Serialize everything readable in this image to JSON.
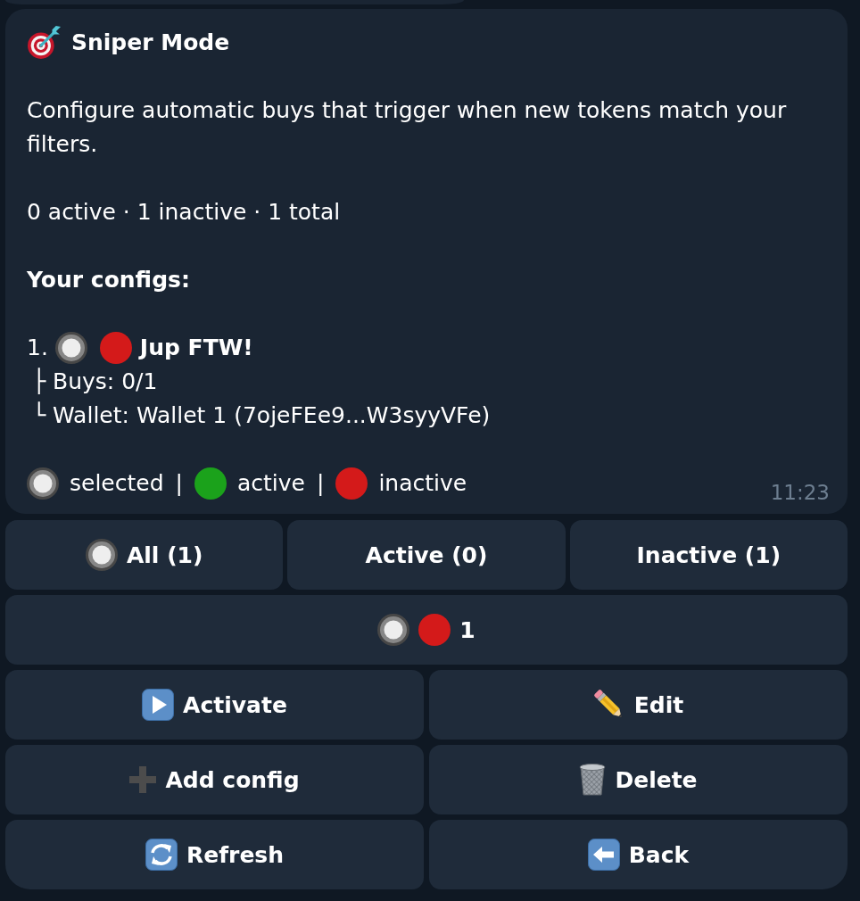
{
  "message": {
    "title": "Sniper Mode",
    "description": "Configure automatic buys that trigger when new tokens match your filters.",
    "summary": "0 active · 1 inactive · 1 total",
    "configs_heading": "Your configs:",
    "configs": [
      {
        "number": "1.",
        "selected": true,
        "active": false,
        "name": "Jup FTW!",
        "details": [
          "├ Buys: 0/1",
          "└ Wallet: Wallet 1 (7ojeFEe9...W3syyVFe)"
        ]
      }
    ],
    "legend": [
      {
        "kind": "radio",
        "label": "selected",
        "separator": "|"
      },
      {
        "kind": "dot",
        "color": "#1ba21b",
        "label": "active",
        "separator": "|"
      },
      {
        "kind": "dot",
        "color": "#d41a1a",
        "label": "inactive"
      }
    ],
    "time": "11:23"
  },
  "keyboard": {
    "filters": [
      {
        "label": "All (1)",
        "selected": true
      },
      {
        "label": "Active (0)",
        "selected": false
      },
      {
        "label": "Inactive (1)",
        "selected": false
      }
    ],
    "config_buttons": [
      {
        "label": "1",
        "selected": true,
        "active": false
      }
    ],
    "actions": [
      {
        "kind": "activate",
        "label": "Activate"
      },
      {
        "kind": "edit",
        "label": "Edit"
      },
      {
        "kind": "add",
        "label": "Add config"
      },
      {
        "kind": "delete",
        "label": "Delete"
      },
      {
        "kind": "refresh",
        "label": "Refresh"
      },
      {
        "kind": "back",
        "label": "Back"
      }
    ]
  }
}
